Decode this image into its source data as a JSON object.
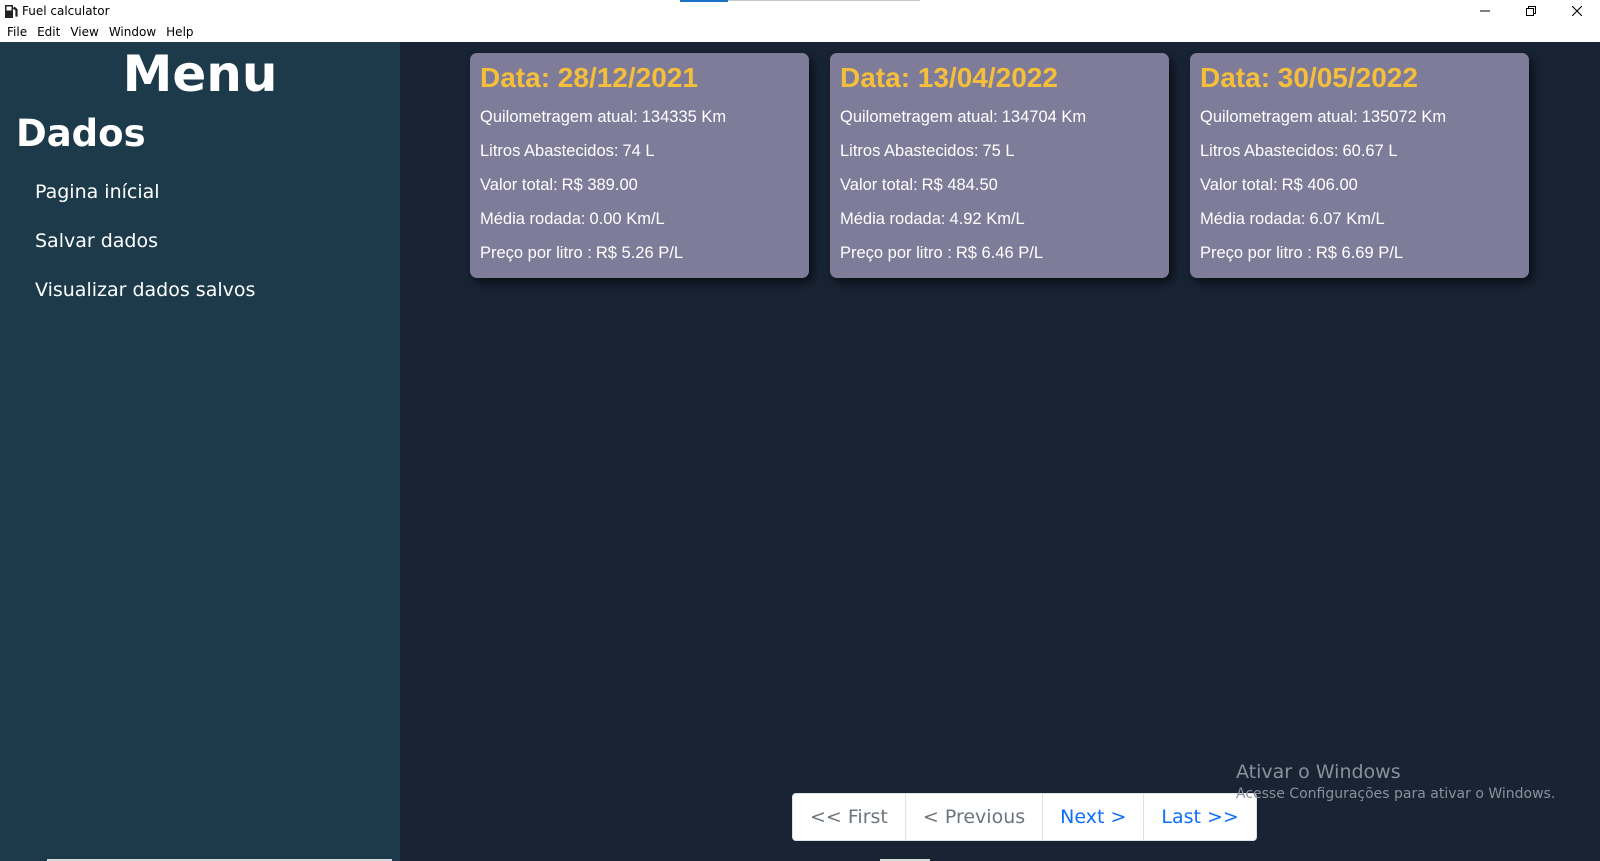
{
  "window": {
    "title": "Fuel calculator",
    "icon": "fuel-pump-icon"
  },
  "menubar": {
    "items": [
      "File",
      "Edit",
      "View",
      "Window",
      "Help"
    ]
  },
  "sidebar": {
    "title": "Menu",
    "section": "Dados",
    "links": [
      "Pagina inícial",
      "Salvar dados",
      "Visualizar dados salvos"
    ]
  },
  "cards": [
    {
      "date": "Data: 28/12/2021",
      "lines": [
        {
          "label": "Quilometragem atual:",
          "value": "134335 Km"
        },
        {
          "label": "Litros Abastecidos:",
          "value": "74 L"
        },
        {
          "label": "Valor total:",
          "value": "R$ 389.00"
        },
        {
          "label": "Média rodada:",
          "value": "0.00 Km/L"
        },
        {
          "label": "Preço por litro :",
          "value": "R$ 5.26 P/L"
        }
      ]
    },
    {
      "date": "Data: 13/04/2022",
      "lines": [
        {
          "label": "Quilometragem atual:",
          "value": "134704 Km"
        },
        {
          "label": "Litros Abastecidos:",
          "value": "75 L"
        },
        {
          "label": "Valor total:",
          "value": "R$ 484.50"
        },
        {
          "label": "Média rodada:",
          "value": "4.92 Km/L"
        },
        {
          "label": "Preço por litro :",
          "value": "R$ 6.46 P/L"
        }
      ]
    },
    {
      "date": "Data: 30/05/2022",
      "lines": [
        {
          "label": "Quilometragem atual:",
          "value": "135072 Km"
        },
        {
          "label": "Litros Abastecidos:",
          "value": "60.67 L"
        },
        {
          "label": "Valor total:",
          "value": "R$ 406.00"
        },
        {
          "label": "Média rodada:",
          "value": "6.07 Km/L"
        },
        {
          "label": "Preço por litro :",
          "value": "R$ 6.69 P/L"
        }
      ]
    }
  ],
  "pagination": {
    "first": "<< First",
    "previous": "< Previous",
    "next": "Next >",
    "last": "Last >>"
  },
  "watermark": {
    "title": "Ativar o Windows",
    "subtitle": "Acesse Configurações para ativar o Windows."
  },
  "colors": {
    "sidebar": "#1d3a4a",
    "main_bg": "#182334",
    "card_bg": "#7e7c99",
    "date_accent": "#f5be3b",
    "link_active": "#0d6efd",
    "link_disabled": "#6c757d"
  }
}
